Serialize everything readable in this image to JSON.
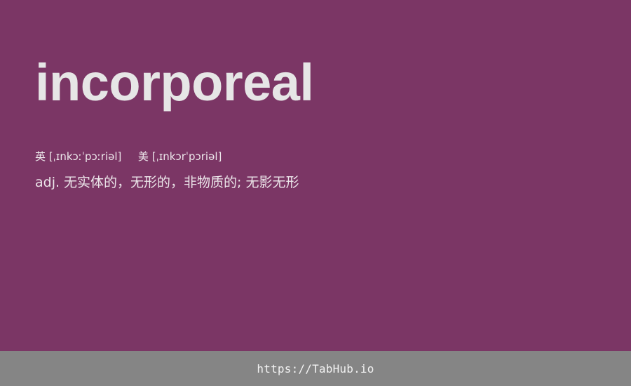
{
  "theme": {
    "background": "#7b3665",
    "footer_background": "#858585",
    "text_color": "#e6e6e6"
  },
  "card": {
    "word": "incorporeal",
    "phonetics": {
      "uk_label": "英",
      "uk_ipa": "[ˌɪnkɔːˈpɔːriəl]",
      "us_label": "美",
      "us_ipa": "[ˌɪnkɔrˈpɔriəl]"
    },
    "definition": "adj. 无实体的，无形的，非物质的; 无影无形"
  },
  "footer": {
    "link_text": "https://TabHub.io"
  }
}
